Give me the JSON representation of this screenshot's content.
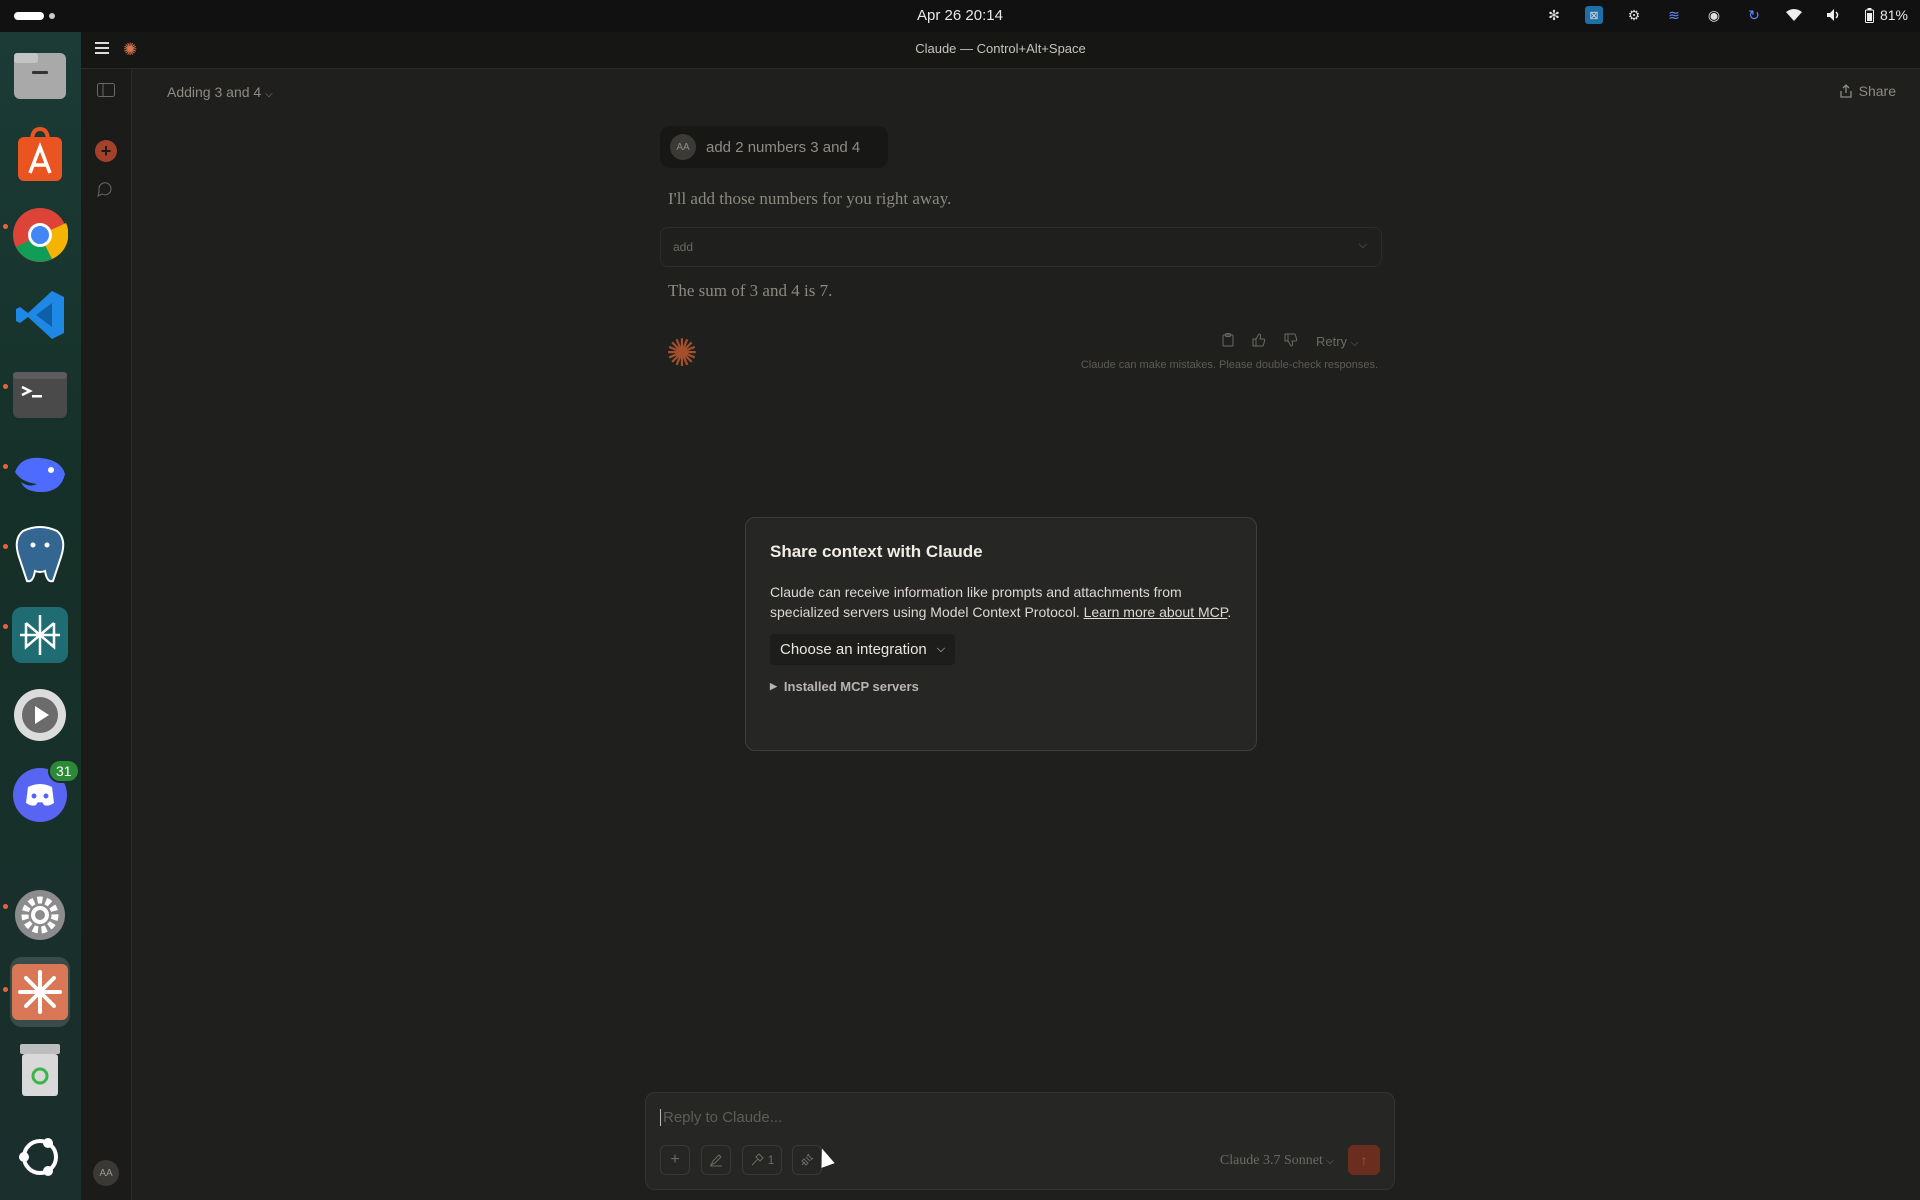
{
  "topbar": {
    "clock": "Apr 26  20:14",
    "battery": "81%",
    "tray_icons": [
      "claude-tray-icon",
      "xcode-tray-icon",
      "settings-tray-icon",
      "vpn-tray-icon",
      "discord-tray-icon",
      "refresh-tray-icon",
      "wifi-icon",
      "volume-icon",
      "battery-icon"
    ]
  },
  "dock": {
    "items": [
      "files-icon",
      "app-center-icon",
      "chrome-icon",
      "vscode-icon",
      "terminal-icon",
      "deepseek-icon",
      "postgres-icon",
      "perplexity-icon",
      "media-player-icon",
      "discord-icon",
      "settings-icon",
      "claude-icon",
      "trash-icon",
      "ubuntu-icon"
    ],
    "discord_badge": "31"
  },
  "window": {
    "title": "Claude — Control+Alt+Space"
  },
  "sidebar": {
    "avatar": "AA"
  },
  "conversation": {
    "title": "Adding 3 and 4",
    "share_label": "Share",
    "user_initials": "AA",
    "user_message": "add 2 numbers 3 and 4",
    "response_intro": "I'll add those numbers for you right away.",
    "tool_name": "add",
    "response_result": "The sum of 3 and 4 is 7.",
    "retry_label": "Retry",
    "disclaimer": "Claude can make mistakes. Please double-check responses."
  },
  "modal": {
    "title": "Share context with Claude",
    "body": "Claude can receive information like prompts and attachments from specialized servers using Model Context Protocol.",
    "link": "Learn more about MCP",
    "select_label": "Choose an integration",
    "installed_label": "Installed MCP servers"
  },
  "composer": {
    "placeholder": "Reply to Claude...",
    "tools_count": "1",
    "model": "Claude 3.7 Sonnet"
  },
  "colors": {
    "accent": "#d8764f",
    "background": "#1f1f1d",
    "modal": "#262624"
  }
}
